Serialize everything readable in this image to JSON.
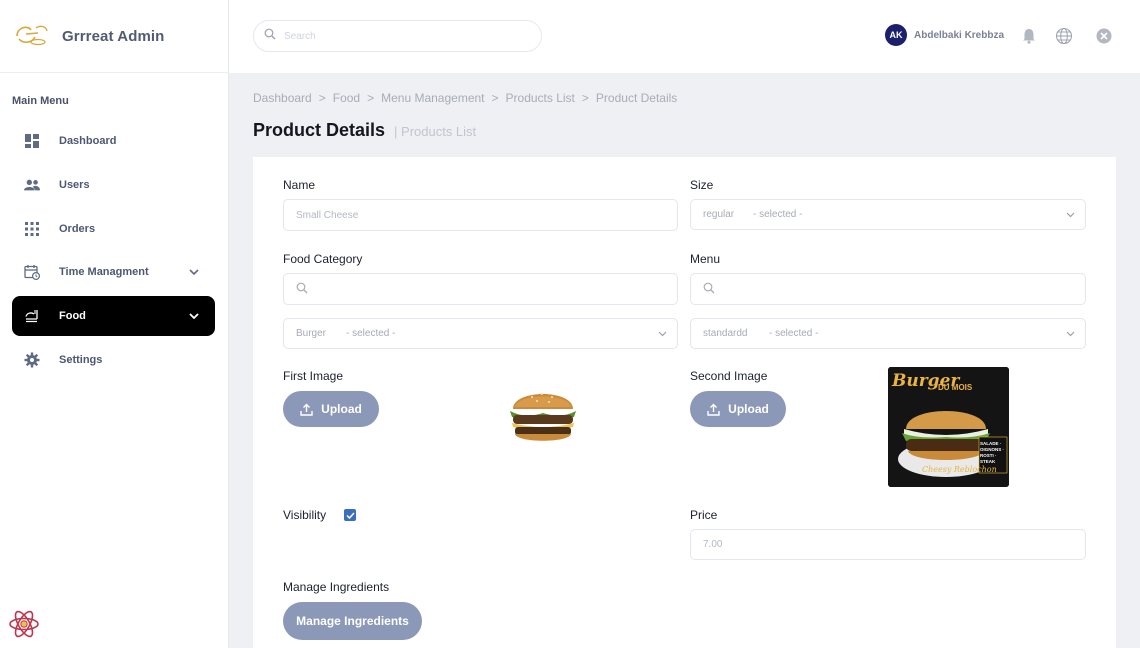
{
  "app": {
    "title": "Grrreat Admin"
  },
  "sidebar": {
    "heading": "Main Menu",
    "items": [
      {
        "label": "Dashboard",
        "icon": "dashboard-icon"
      },
      {
        "label": "Users",
        "icon": "users-icon"
      },
      {
        "label": "Orders",
        "icon": "orders-icon"
      },
      {
        "label": "Time Managment",
        "icon": "calendar-clock-icon",
        "expandable": true
      },
      {
        "label": "Food",
        "icon": "food-icon",
        "expandable": true,
        "active": true
      },
      {
        "label": "Settings",
        "icon": "gear-icon"
      }
    ]
  },
  "topbar": {
    "search_placeholder": "Search",
    "user": {
      "initials": "AK",
      "name": "Abdelbaki Krebbza"
    },
    "icons": [
      "bell-icon",
      "globe-icon",
      "close-circle-icon"
    ]
  },
  "breadcrumb": [
    "Dashboard",
    "Food",
    "Menu Management",
    "Products List",
    "Product Details"
  ],
  "page": {
    "title": "Product Details",
    "subtitle": "| Products List"
  },
  "form": {
    "name": {
      "label": "Name",
      "placeholder": "Small Cheese"
    },
    "size": {
      "label": "Size",
      "value": "regular",
      "hint": "- selected -"
    },
    "food_category": {
      "label": "Food Category",
      "search_placeholder": "",
      "value": "Burger",
      "hint": "- selected -"
    },
    "menu": {
      "label": "Menu",
      "search_placeholder": "",
      "value": "standardd",
      "hint": "- selected -"
    },
    "first_image": {
      "label": "First Image",
      "button": "Upload"
    },
    "second_image": {
      "label": "Second Image",
      "button": "Upload",
      "poster_text": {
        "headline": "Burger",
        "sub": "DU MOIS",
        "side": "SALADE · OIGNONS · ROSTI · STEAK",
        "bottom": "Cheesy Reblochon"
      }
    },
    "visibility": {
      "label": "Visibility",
      "checked": true
    },
    "price": {
      "label": "Price",
      "placeholder": "7.00"
    },
    "ingredients": {
      "label": "Manage Ingredients",
      "button": "Manage Ingredients"
    }
  },
  "colors": {
    "accent": "#8b98b8",
    "active_menu_bg": "#000000",
    "avatar_bg": "#1a1f6e",
    "checkbox": "#3a6fc0"
  }
}
